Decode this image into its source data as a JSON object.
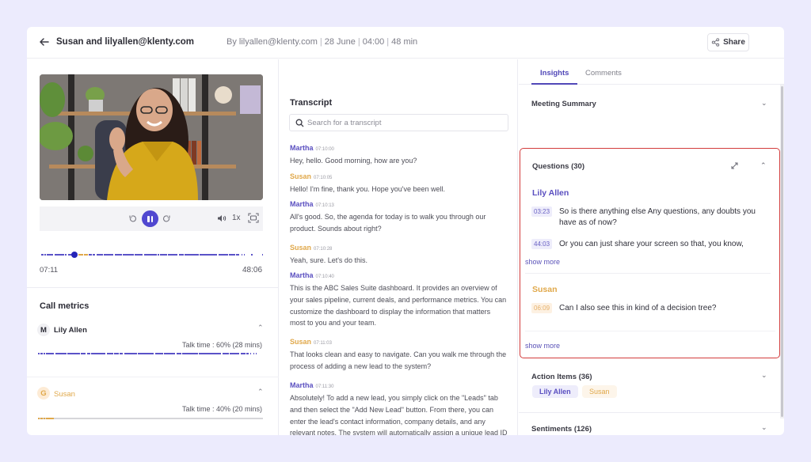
{
  "header": {
    "title": "Susan and lilyallen@klenty.com",
    "meta_by": "By lilyallen@klenty.com",
    "meta_date": "28 June",
    "meta_time": "04:00",
    "meta_duration": "48 min",
    "share_label": "Share"
  },
  "player": {
    "speed": "1x",
    "current_time": "07:11",
    "total_time": "48:06",
    "progress_fraction": 0.15
  },
  "call_metrics": {
    "title": "Call metrics",
    "speakers": [
      {
        "initial": "M",
        "name": "Lily Allen",
        "talk_time": "Talk time : 60% (28 mins)",
        "talk_percent": 60
      },
      {
        "initial": "G",
        "name": "Susan",
        "talk_time": "Talk time : 40% (20 mins)",
        "talk_percent": 40
      }
    ]
  },
  "transcript": {
    "title": "Transcript",
    "search_placeholder": "Search for a transcript",
    "messages": [
      {
        "speaker": "Martha",
        "time": "07:10:00",
        "text": "Hey, hello. Good morning, how are you?"
      },
      {
        "speaker": "Susan",
        "time": "07:10:05",
        "text": "Hello! I'm fine, thank you. Hope you've been well."
      },
      {
        "speaker": "Martha",
        "time": "07:10:13",
        "text": "All's good. So, the agenda for today is to walk you through our product. Sounds about right?"
      },
      {
        "speaker": "Susan",
        "time": "07:10:28",
        "text": "Yeah, sure. Let's do this."
      },
      {
        "speaker": "Martha",
        "time": "07:10:40",
        "text": "This is the ABC Sales Suite dashboard. It provides an overview of your sales pipeline, current deals, and performance metrics. You can customize the dashboard to display the information that matters most to you and your team."
      },
      {
        "speaker": "Susan",
        "time": "07:11:03",
        "text": "That looks clean and easy to navigate. Can you walk me through the process of adding a new lead to the system?"
      },
      {
        "speaker": "Martha",
        "time": "07:11:30",
        "text": "Absolutely! To add a new lead, you simply click on the \"Leads\" tab and then select the \"Add New Lead\" button. From there, you can enter the lead's contact information, company details, and any relevant notes. The system will automatically assign a unique lead ID and add it to your pipeline."
      }
    ]
  },
  "insights": {
    "tabs": [
      {
        "label": "Insights",
        "active": true
      },
      {
        "label": "Comments",
        "active": false
      }
    ],
    "meeting_summary": "Meeting Summary",
    "questions": {
      "title": "Questions (30)",
      "groups": [
        {
          "speaker": "Lily Allen",
          "items": [
            {
              "time": "03:23",
              "text": "So is there anything else Any questions, any doubts you have as of now?"
            },
            {
              "time": "44:03",
              "text": "Or you can just share your screen so that, you know,"
            }
          ],
          "show_more": "show more"
        },
        {
          "speaker": "Susan",
          "items": [
            {
              "time": "06:09",
              "text": "Can I also see this in kind of a decision tree?"
            }
          ],
          "show_more": "show more"
        }
      ]
    },
    "action_items": {
      "title": "Action Items (36)",
      "chips": [
        "Lily Allen",
        "Susan"
      ]
    },
    "sentiments": "Sentiments (126)"
  },
  "colors": {
    "accent": "#5148d0",
    "martha": "#5a4fc0",
    "susan": "#e0a84a",
    "highlight_border": "#d33c3c",
    "page_bg": "#ecebfd"
  }
}
